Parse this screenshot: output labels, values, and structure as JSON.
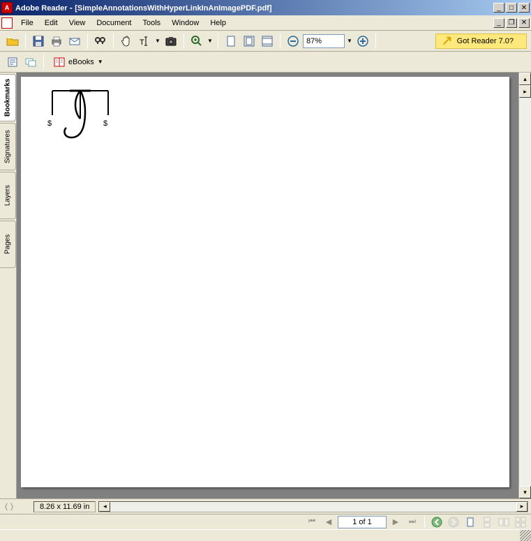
{
  "titlebar": {
    "app": "Adobe Reader",
    "doc": "[SimpleAnnotationsWithHyperLinkInAnImagePDF.pdf]"
  },
  "menu": {
    "file": "File",
    "edit": "Edit",
    "view": "View",
    "document": "Document",
    "tools": "Tools",
    "window": "Window",
    "help": "Help"
  },
  "toolbar": {
    "zoom": "87%",
    "promo": "Got Reader 7.0?"
  },
  "toolbar2": {
    "ebooks": "eBooks"
  },
  "sidetabs": {
    "bookmarks": "Bookmarks",
    "signatures": "Signatures",
    "layers": "Layers",
    "pages": "Pages"
  },
  "status": {
    "pagesize": "8.26 x 11.69 in"
  },
  "nav": {
    "page": "1 of 1"
  }
}
